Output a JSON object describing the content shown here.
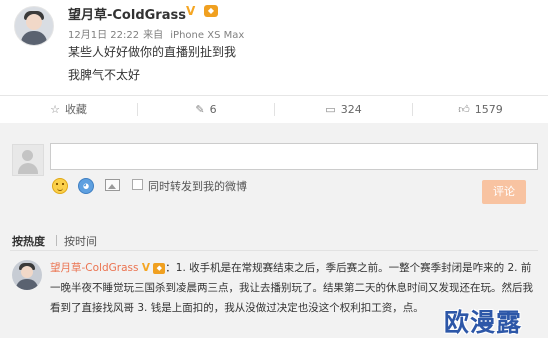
{
  "post": {
    "author": "望月草-ColdGrass",
    "time": "12月1日 22:22",
    "source_prefix": "来自",
    "device": "iPhone XS Max",
    "lines": [
      "某些人好好做你的直播别扯到我",
      "我脾气不太好"
    ]
  },
  "actions": {
    "favorite": "收藏",
    "forward_count": "6",
    "comment_count": "324",
    "like_count": "1579"
  },
  "composer": {
    "placeholder": "",
    "forward_label": "同时转发到我的微博",
    "submit_label": "评论"
  },
  "sort": {
    "by_hot": "按热度",
    "by_time": "按时间"
  },
  "comment": {
    "author": "望月草-ColdGrass",
    "text": "：1. 收手机是在常规赛结束之后，季后赛之前。一整个赛季封闭是咋来的 2. 前一晚半夜不睡觉玩三国杀到凌晨两三点，我让去播别玩了。结果第二天的休息时间又发现还在玩。然后我看到了直接找风哥 3. 钱是上面扣的，我从没做过决定也没这个权利扣工资，点。"
  },
  "watermark": "欧漫露",
  "colors": {
    "accent": "#eb7350",
    "vip": "#f5a623",
    "submit_disabled": "#f8c3a1",
    "watermark": "#2d57a8"
  },
  "icons": [
    "star-icon",
    "edit-icon",
    "comment-icon",
    "thumb-up-icon",
    "emoji-icon",
    "sticker-icon",
    "image-icon"
  ]
}
